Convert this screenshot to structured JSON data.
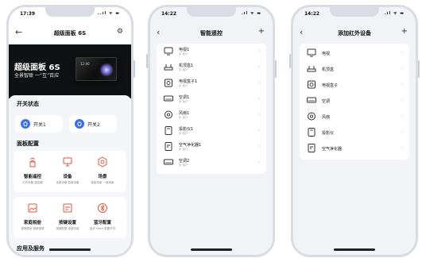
{
  "colors": {
    "accent": "#3b6fe8",
    "icon_red": "#e0533d",
    "screen_bg": "#f2f3f6"
  },
  "phone1": {
    "status": {
      "time": "17:39",
      "icons": "..ıl ᯤ ▬"
    },
    "nav": {
      "back": "←",
      "title": "超级面板 6S",
      "settings_icon": "⚙"
    },
    "hero": {
      "title": "超级面板 6S",
      "subtitle": "全景智联 一“互”百应",
      "panel_time": "12:00"
    },
    "switch_section": {
      "title": "开关状态",
      "items": [
        {
          "label": "开关1"
        },
        {
          "label": "开关2"
        }
      ]
    },
    "panel_section": {
      "title": "面板配置",
      "items": [
        {
          "title": "智能遥控",
          "sub": "红外设备 遥控器",
          "icon": "remote-icon"
        },
        {
          "title": "设备",
          "sub": "全屋设备 智能设备",
          "icon": "device-icon"
        },
        {
          "title": "场景",
          "sub": "智能场景 一键场景",
          "icon": "scene-icon"
        },
        {
          "title": "家庭相册",
          "sub": "更换壁纸 相册管理",
          "icon": "album-icon"
        },
        {
          "title": "按键设置",
          "sub": "按键配置 按键功能",
          "icon": "key-icon"
        },
        {
          "title": "蓝牙配置",
          "sub": "蓝牙 Mesh 配置开关",
          "icon": "bluetooth-icon"
        }
      ]
    },
    "apps_section": {
      "title": "应用及服务"
    }
  },
  "phone2": {
    "status": {
      "time": "14:22",
      "icons": ".ıl ᯤ ▬"
    },
    "nav": {
      "back": "‹",
      "title": "智能遥控",
      "plus": "+"
    },
    "items": [
      {
        "name": "电视1",
        "sub": "卧 客厅",
        "icon": "tv-icon"
      },
      {
        "name": "机顶盒1",
        "sub": "卧 客厅",
        "icon": "settop-box-icon"
      },
      {
        "name": "电视盒子1",
        "sub": "卧 客厅",
        "icon": "tv-box-icon"
      },
      {
        "name": "空调1",
        "sub": "卧 客厅",
        "icon": "air-conditioner-icon"
      },
      {
        "name": "风扇1",
        "sub": "卧 客厅",
        "icon": "fan-icon"
      },
      {
        "name": "投影仪1",
        "sub": "卧 客厅",
        "icon": "projector-icon"
      },
      {
        "name": "空气净化器1",
        "sub": "卧 客厅",
        "icon": "air-purifier-icon"
      },
      {
        "name": "空调2",
        "sub": "卧 客厅",
        "icon": "air-conditioner-icon"
      }
    ]
  },
  "phone3": {
    "status": {
      "time": "14:22",
      "icons": ".ıl ᯤ ▬"
    },
    "nav": {
      "back": "‹",
      "title": "添加红外设备",
      "plus": "+"
    },
    "items": [
      {
        "name": "电视",
        "icon": "tv-icon"
      },
      {
        "name": "机顶盒",
        "icon": "settop-box-icon"
      },
      {
        "name": "电视盒子",
        "icon": "tv-box-icon"
      },
      {
        "name": "空调",
        "icon": "air-conditioner-icon"
      },
      {
        "name": "风扇",
        "icon": "fan-icon"
      },
      {
        "name": "投影仪",
        "icon": "projector-icon"
      },
      {
        "name": "空气净化器",
        "icon": "air-purifier-icon"
      }
    ]
  }
}
